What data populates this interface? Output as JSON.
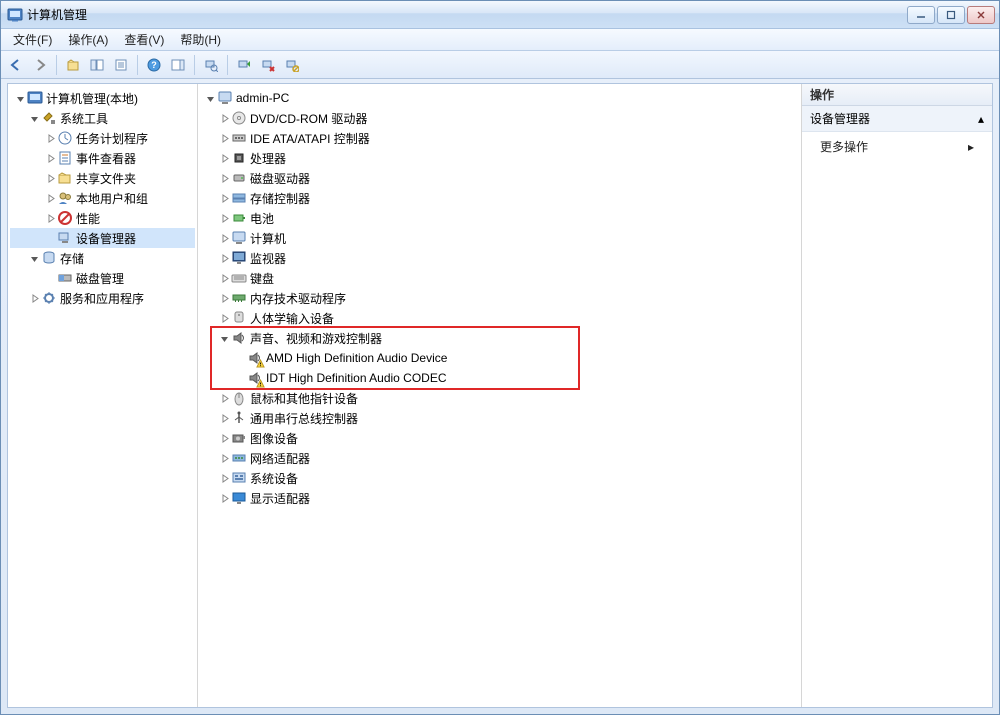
{
  "window": {
    "title": "计算机管理"
  },
  "menubar": {
    "file": "文件(F)",
    "action": "操作(A)",
    "view": "查看(V)",
    "help": "帮助(H)"
  },
  "left_tree": {
    "root": "计算机管理(本地)",
    "nodes": [
      {
        "label": "系统工具",
        "expanded": true,
        "children": [
          {
            "label": "任务计划程序"
          },
          {
            "label": "事件查看器"
          },
          {
            "label": "共享文件夹"
          },
          {
            "label": "本地用户和组"
          },
          {
            "label": "性能"
          },
          {
            "label": "设备管理器",
            "selected": true
          }
        ]
      },
      {
        "label": "存储",
        "expanded": true,
        "children": [
          {
            "label": "磁盘管理"
          }
        ]
      },
      {
        "label": "服务和应用程序",
        "expanded": false
      }
    ]
  },
  "center_tree": {
    "root": "admin-PC",
    "devices": [
      {
        "label": "DVD/CD-ROM 驱动器",
        "icon": "disc"
      },
      {
        "label": "IDE ATA/ATAPI 控制器",
        "icon": "controller"
      },
      {
        "label": "处理器",
        "icon": "cpu"
      },
      {
        "label": "磁盘驱动器",
        "icon": "disk"
      },
      {
        "label": "存储控制器",
        "icon": "storage-ctrl"
      },
      {
        "label": "电池",
        "icon": "battery"
      },
      {
        "label": "计算机",
        "icon": "computer"
      },
      {
        "label": "监视器",
        "icon": "monitor"
      },
      {
        "label": "键盘",
        "icon": "keyboard"
      },
      {
        "label": "内存技术驱动程序",
        "icon": "memory"
      },
      {
        "label": "人体学输入设备",
        "icon": "hid"
      },
      {
        "label": "声音、视频和游戏控制器",
        "icon": "audio",
        "expanded": true,
        "children": [
          {
            "label": "AMD High Definition Audio Device",
            "icon": "audio",
            "warn": true
          },
          {
            "label": "IDT High Definition Audio CODEC",
            "icon": "audio",
            "warn": true
          }
        ]
      },
      {
        "label": "鼠标和其他指针设备",
        "icon": "mouse"
      },
      {
        "label": "通用串行总线控制器",
        "icon": "usb"
      },
      {
        "label": "图像设备",
        "icon": "camera"
      },
      {
        "label": "网络适配器",
        "icon": "network"
      },
      {
        "label": "系统设备",
        "icon": "system"
      },
      {
        "label": "显示适配器",
        "icon": "display"
      }
    ]
  },
  "actions": {
    "title": "操作",
    "section": "设备管理器",
    "more": "更多操作"
  }
}
